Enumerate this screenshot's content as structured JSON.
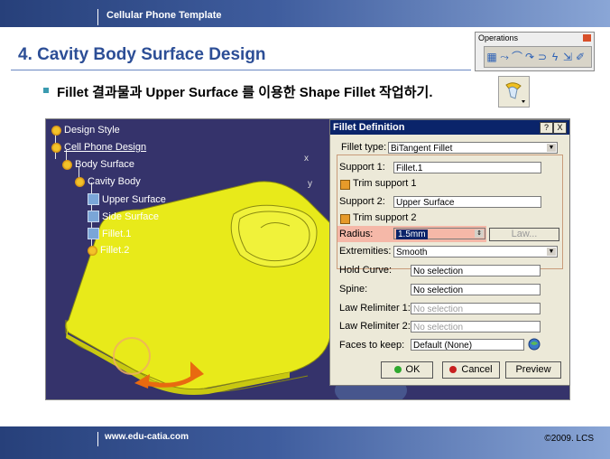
{
  "header": {
    "template_title": "Cellular Phone Template"
  },
  "slide": {
    "heading": "4. Cavity Body Surface Design",
    "bullet": "Fillet 결과물과 Upper Surface 를 이용한 Shape Fillet 작업하기."
  },
  "operations_toolbar": {
    "title": "Operations",
    "icons": [
      "join-icon",
      "fillet-icon",
      "blend-icon",
      "trim-icon",
      "extract-icon",
      "split-icon",
      "transform-icon",
      "extrapolate-icon"
    ]
  },
  "spec_tree": {
    "items": [
      {
        "label": "Design Style",
        "icon": "gear-icon"
      },
      {
        "label": "Cell Phone Design",
        "icon": "gear-icon"
      },
      {
        "label": "Body Surface",
        "icon": "gear-icon"
      },
      {
        "label": "Cavity Body",
        "icon": "gear-icon"
      },
      {
        "label": "Upper Surface",
        "icon": "surface-icon"
      },
      {
        "label": "Side Surface",
        "icon": "surface-icon"
      },
      {
        "label": "Fillet.1",
        "icon": "surface-icon"
      },
      {
        "label": "Fillet.2",
        "icon": "fillet-icon"
      }
    ]
  },
  "axes": {
    "x": "x",
    "y": "y"
  },
  "dialog": {
    "title": "Fillet Definition",
    "help_button": "?",
    "close_button": "X",
    "fillet_type_label": "Fillet type:",
    "fillet_type_value": "BiTangent Fillet",
    "support1_label": "Support 1:",
    "support1_value": "Fillet.1",
    "trim_support1": "Trim support 1",
    "support2_label": "Support 2:",
    "support2_value": "Upper Surface",
    "trim_support2": "Trim support 2",
    "radius_label": "Radius:",
    "radius_value": "1.5mm",
    "law_button": "Law...",
    "extremities_label": "Extremities:",
    "extremities_value": "Smooth",
    "hold_curve_label": "Hold Curve:",
    "hold_curve_value": "No selection",
    "spine_label": "Spine:",
    "spine_value": "No selection",
    "law_relimiter1_label": "Law Relimiter 1:",
    "law_relimiter1_value": "No selection",
    "law_relimiter2_label": "Law Relimiter 2:",
    "law_relimiter2_value": "No selection",
    "faces_to_keep_label": "Faces to keep:",
    "faces_to_keep_value": "Default (None)",
    "ok_button": "OK",
    "cancel_button": "Cancel",
    "preview_button": "Preview"
  },
  "footer": {
    "url": "www.edu-catia.com",
    "copyright": "©2009. LCS"
  },
  "colors": {
    "accent": "#2c4e96",
    "viewport_bg": "#35336b",
    "part": "#e8ea1a",
    "radius_highlight": "#f5b8a8",
    "ok_dot": "#2ea82e",
    "cancel_dot": "#c82020"
  }
}
